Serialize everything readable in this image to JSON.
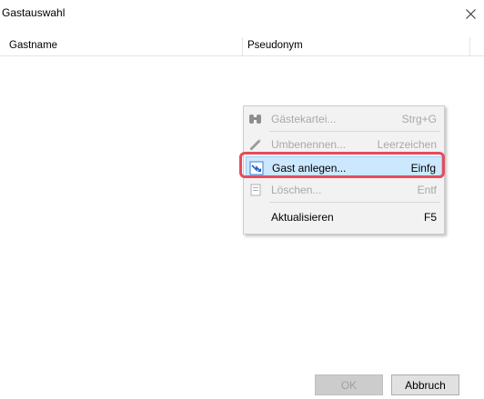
{
  "window": {
    "title": "Gastauswahl"
  },
  "table": {
    "columns": [
      "Gastname",
      "Pseudonym"
    ]
  },
  "context_menu": {
    "items": [
      {
        "label": "Gästekartei...",
        "shortcut": "Strg+G",
        "icon": "guests-binoculars-icon",
        "enabled": false
      },
      {
        "label": "Umbenennen...",
        "shortcut": "Leerzeichen",
        "icon": "pencil-icon",
        "enabled": false
      },
      {
        "label": "Gast anlegen...",
        "shortcut": "Einfg",
        "icon": "new-guest-icon",
        "enabled": true,
        "highlighted": true
      },
      {
        "label": "Löschen...",
        "shortcut": "Entf",
        "icon": "delete-icon",
        "enabled": false
      },
      {
        "label": "Aktualisieren",
        "shortcut": "F5",
        "enabled": true
      }
    ]
  },
  "buttons": {
    "ok": "OK",
    "cancel": "Abbruch"
  },
  "colors": {
    "highlight_ring": "#e64c5c",
    "menu_hover": "#cce8ff"
  }
}
